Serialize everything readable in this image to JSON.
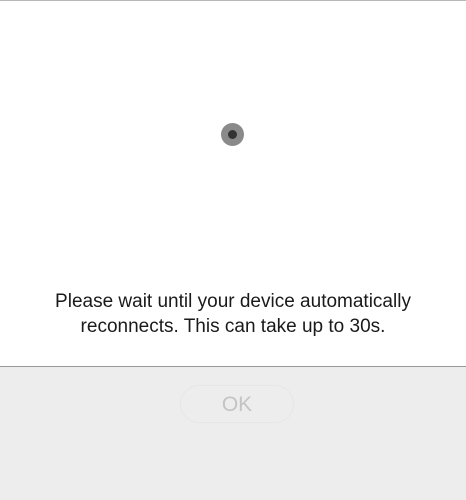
{
  "dialog": {
    "message": "Please wait until your device automatically reconnects. This can take up to 30s.",
    "ok_label": "OK",
    "spinner_icon": "loading-spinner-icon"
  }
}
